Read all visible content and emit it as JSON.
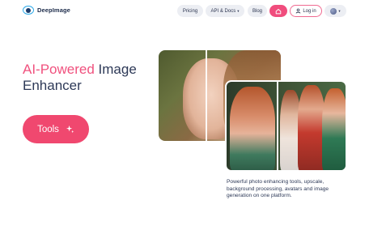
{
  "header": {
    "logo_text": "DeepImage",
    "nav": {
      "pricing": "Pricing",
      "api_docs": "API & Docs",
      "api_caret": "▾",
      "blog": "Blog"
    },
    "home_icon": "home-icon",
    "login_label": "Log in",
    "login_icon": "user-icon",
    "language_icon": "globe-icon",
    "language_caret": "▾"
  },
  "hero": {
    "title_accent": "AI-Powered",
    "title_rest_line1": " Image",
    "title_line2": "Enhancer",
    "tools_button": "Tools",
    "tools_icon": "sparkle-icon",
    "description": "Powerful photo enhancing tools, upscale, background processing, avatars and image generation on one platform."
  },
  "colors": {
    "accent": "#f0486f",
    "logo_blue": "#2aa8e8",
    "text_dark": "#2d3957"
  }
}
